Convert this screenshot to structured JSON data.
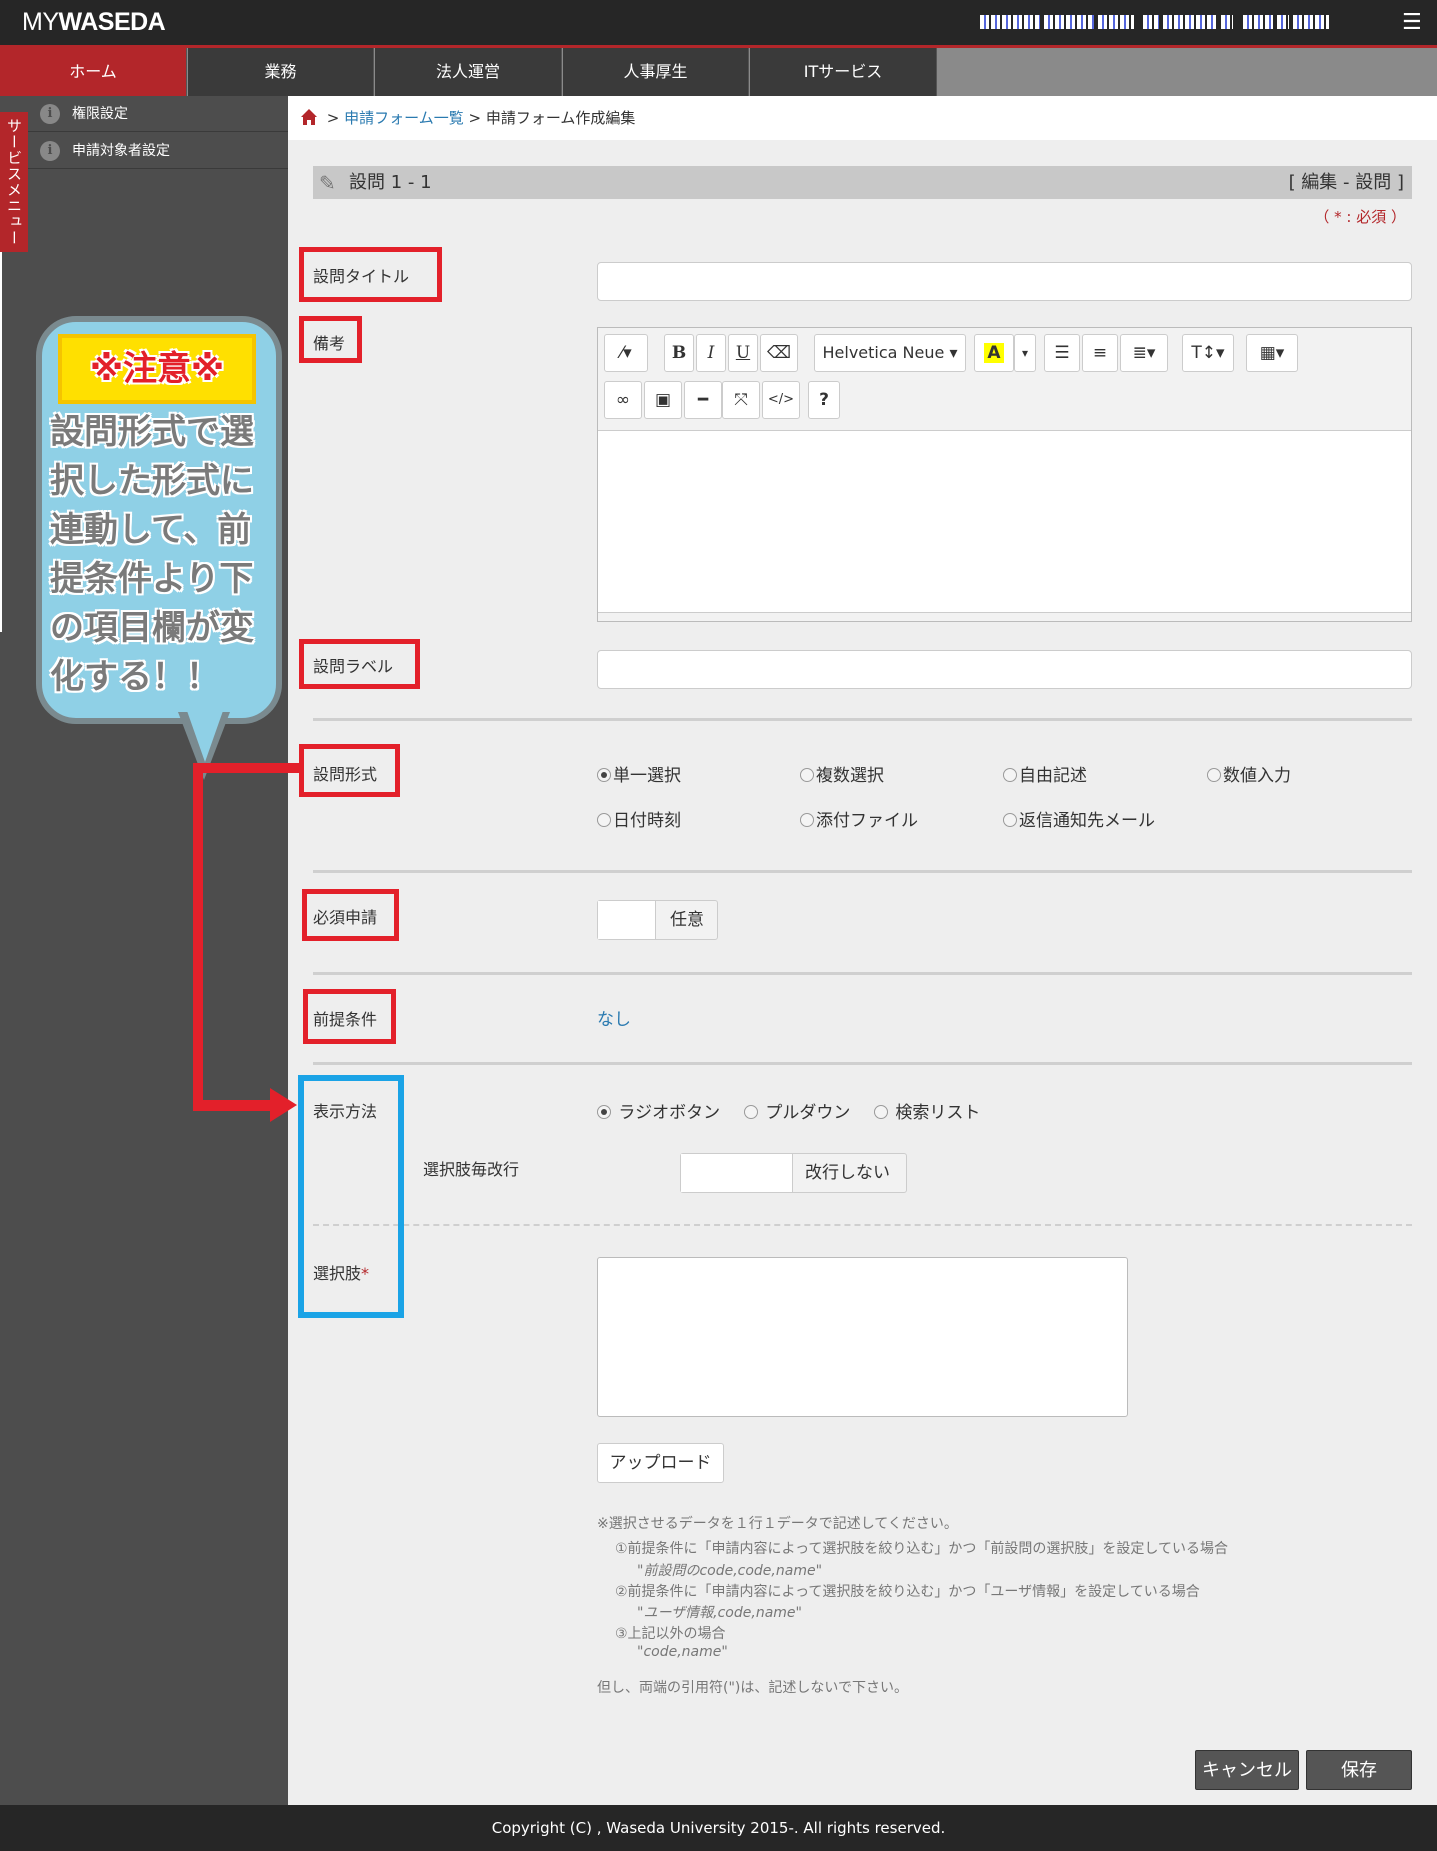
{
  "header": {
    "logo_prefix": "MY",
    "logo_main": "WASEDA",
    "menu_icon": "hamburger-list-icon"
  },
  "nav": {
    "tabs": [
      "ホーム",
      "業務",
      "法人運営",
      "人事厚生",
      "ITサービス"
    ],
    "active": "ホーム"
  },
  "sidebar": {
    "service_menu": "サービスメニュー",
    "items": [
      "権限設定",
      "申請対象者設定"
    ]
  },
  "breadcrumb": {
    "link": "申請フォーム一覧",
    "sep": ">",
    "current": "申請フォーム作成編集"
  },
  "section": {
    "title": "設問 1 - 1",
    "mode": "[ 編集 - 設問 ]",
    "required_note": "（ * : 必須 ）"
  },
  "form": {
    "title_label": "設問タイトル",
    "remarks_label": "備考",
    "question_label_label": "設問ラベル",
    "format_label": "設問形式",
    "format_options": [
      "単一選択",
      "複数選択",
      "自由記述",
      "数値入力",
      "日付時刻",
      "添付ファイル",
      "返信通知先メール"
    ],
    "format_selected": "単一選択",
    "required_label": "必須申請",
    "required_toggle": "任意",
    "precondition_label": "前提条件",
    "precondition_value": "なし",
    "display_label": "表示方法",
    "display_options": [
      "ラジオボタン",
      "プルダウン",
      "検索リスト"
    ],
    "display_selected": "ラジオボタン",
    "linebreak_label": "選択肢毎改行",
    "linebreak_toggle": "改行しない",
    "choices_label": "選択肢",
    "choices_required": "*",
    "upload_button": "アップロード"
  },
  "editor": {
    "font_name": "Helvetica Neue",
    "toolbar_icons": [
      "magic-wand-icon",
      "bold-icon",
      "italic-icon",
      "underline-icon",
      "eraser-icon",
      "font-family-dropdown",
      "font-color-icon",
      "unordered-list-icon",
      "ordered-list-icon",
      "align-icon",
      "line-height-icon",
      "table-icon",
      "link-icon",
      "picture-icon",
      "horizontal-rule-icon",
      "fullscreen-icon",
      "code-view-icon",
      "help-icon"
    ],
    "bold": "B",
    "italic": "I",
    "underline": "U",
    "color": "A",
    "help": "?"
  },
  "notes": {
    "line1": "※選択させるデータを１行１データで記述してください。",
    "line2": "①前提条件に「申請内容によって選択肢を絞り込む」かつ「前設問の選択肢」を設定している場合",
    "line3": "\"前設問のcode,code,name\"",
    "line4": "②前提条件に「申請内容によって選択肢を絞り込む」かつ「ユーザ情報」を設定している場合",
    "line5": "\"ユーザ情報,code,name\"",
    "line6": "③上記以外の場合",
    "line7": "\"code,name\"",
    "line8": "但し、両端の引用符(\")は、記述しないで下さい。"
  },
  "buttons": {
    "cancel": "キャンセル",
    "save": "保存"
  },
  "footer": {
    "copyright": "Copyright (C) , Waseda University 2015-. All rights reserved."
  },
  "annotation": {
    "caution": "※注意※",
    "message": "設問形式で選択した形式に連動して、前提条件より下の項目欄が変化する！！"
  },
  "colors": {
    "brand_red": "#b3262a",
    "annotation_red": "#e3202a",
    "annotation_blue": "#1aa3e6",
    "link": "#2a7ab0"
  }
}
